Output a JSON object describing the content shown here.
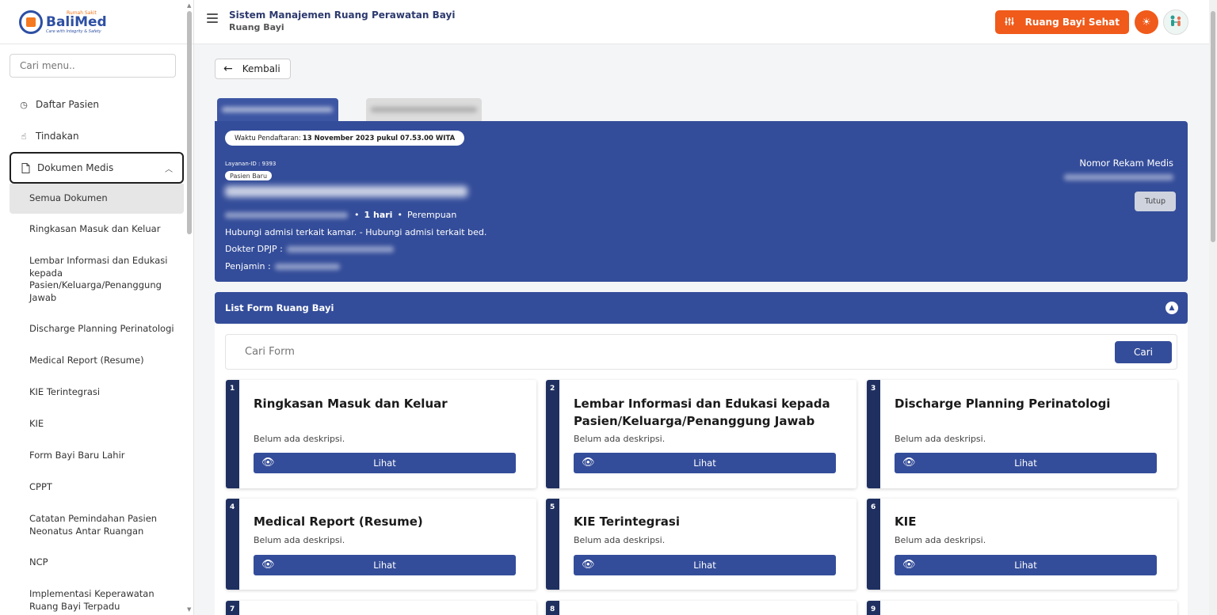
{
  "logo": {
    "small": "Rumah Sakit",
    "name": "BaliMed",
    "tagline": "Care with Integrity & Safety"
  },
  "sidebar": {
    "search_placeholder": "Cari menu..",
    "items": [
      {
        "label": "Daftar Pasien",
        "icon": "clock-icon"
      },
      {
        "label": "Tindakan",
        "icon": "hand-icon"
      },
      {
        "label": "Dokumen Medis",
        "icon": "document-icon"
      }
    ],
    "sub_items": [
      "Semua Dokumen",
      "Ringkasan Masuk dan Keluar",
      "Lembar Informasi dan Edukasi kepada Pasien/Keluarga/Penanggung Jawab",
      "Discharge Planning Perinatologi",
      "Medical Report (Resume)",
      "KIE Terintegrasi",
      "KIE",
      "Form Bayi Baru Lahir",
      "CPPT",
      "Catatan Pemindahan Pasien Neonatus Antar Ruangan",
      "NCP",
      "Implementasi Keperawatan Ruang Bayi Terpadu"
    ]
  },
  "header": {
    "title": "Sistem Manajemen Ruang Perawatan Bayi",
    "subtitle": "Ruang Bayi",
    "room_button": "Ruang Bayi Sehat"
  },
  "back_label": "Kembali",
  "patient": {
    "registration_label": "Waktu Pendaftaran:",
    "registration_value": "13 November 2023 pukul 07.53.00 WITA",
    "layanan": "Layanan-ID : 9393",
    "status_badge": "Pasien Baru",
    "age": "1 hari",
    "gender": "Perempuan",
    "contact_note": "Hubungi admisi terkait kamar. - Hubungi admisi terkait bed.",
    "doctor_label": "Dokter DPJP :",
    "guarantor_label": "Penjamin :",
    "mrn_label": "Nomor Rekam Medis",
    "close_button": "Tutup"
  },
  "form_list": {
    "header": "List Form Ruang Bayi",
    "search_placeholder": "Cari Form",
    "search_button": "Cari",
    "view_label": "Lihat",
    "cards": [
      {
        "num": "1",
        "title": "Ringkasan Masuk dan Keluar",
        "desc": "Belum ada deskripsi."
      },
      {
        "num": "2",
        "title": "Lembar Informasi dan Edukasi kepada Pasien/Keluarga/Penanggung Jawab",
        "desc": "Belum ada deskripsi."
      },
      {
        "num": "3",
        "title": "Discharge Planning Perinatologi",
        "desc": "Belum ada deskripsi."
      },
      {
        "num": "4",
        "title": "Medical Report (Resume)",
        "desc": "Belum ada deskripsi."
      },
      {
        "num": "5",
        "title": "KIE Terintegrasi",
        "desc": "Belum ada deskripsi."
      },
      {
        "num": "6",
        "title": "KIE",
        "desc": "Belum ada deskripsi."
      },
      {
        "num": "7"
      },
      {
        "num": "8"
      },
      {
        "num": "9"
      }
    ]
  },
  "colors": {
    "primary": "#344d9a",
    "accent": "#f05a1a",
    "card_strip": "#1f3060"
  }
}
